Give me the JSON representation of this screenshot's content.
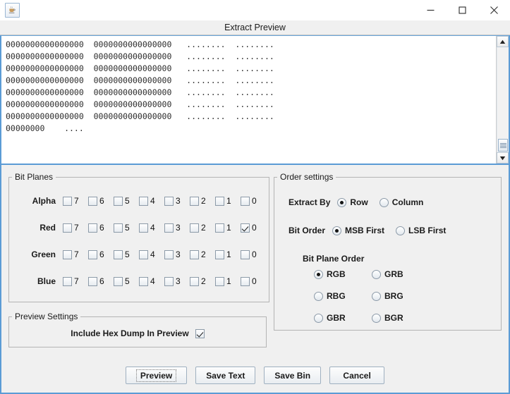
{
  "window": {
    "app_icon": "java-coffee-cup-icon",
    "minimize_label": "–",
    "maximize_label": "□",
    "close_label": "×"
  },
  "header": {
    "title": "Extract Preview"
  },
  "preview": {
    "lines": [
      "0000000000000000  0000000000000000   ........  ........",
      "0000000000000000  0000000000000000   ........  ........",
      "0000000000000000  0000000000000000   ........  ........",
      "0000000000000000  0000000000000000   ........  ........",
      "0000000000000000  0000000000000000   ........  ........",
      "0000000000000000  0000000000000000   ........  ........",
      "0000000000000000  0000000000000000   ........  ........",
      "00000000    ...."
    ],
    "scrollbar": {
      "up_arrow": "scroll-up-icon",
      "down_arrow": "scroll-down-icon"
    }
  },
  "bit_planes": {
    "legend": "Bit Planes",
    "bits": [
      "7",
      "6",
      "5",
      "4",
      "3",
      "2",
      "1",
      "0"
    ],
    "rows": [
      {
        "label": "Alpha",
        "checked": [
          false,
          false,
          false,
          false,
          false,
          false,
          false,
          false
        ]
      },
      {
        "label": "Red",
        "checked": [
          false,
          false,
          false,
          false,
          false,
          false,
          false,
          true
        ]
      },
      {
        "label": "Green",
        "checked": [
          false,
          false,
          false,
          false,
          false,
          false,
          false,
          false
        ]
      },
      {
        "label": "Blue",
        "checked": [
          false,
          false,
          false,
          false,
          false,
          false,
          false,
          false
        ]
      }
    ]
  },
  "preview_settings": {
    "legend": "Preview Settings",
    "include_hex_dump_label": "Include Hex Dump In Preview",
    "include_hex_dump_checked": true
  },
  "order_settings": {
    "legend": "Order settings",
    "extract_by_label": "Extract By",
    "extract_by_options": [
      {
        "label": "Row",
        "selected": true
      },
      {
        "label": "Column",
        "selected": false
      }
    ],
    "bit_order_label": "Bit Order",
    "bit_order_options": [
      {
        "label": "MSB First",
        "selected": true
      },
      {
        "label": "LSB First",
        "selected": false
      }
    ],
    "bit_plane_order_label": "Bit Plane Order",
    "bit_plane_order_options": [
      {
        "label": "RGB",
        "selected": true
      },
      {
        "label": "GRB",
        "selected": false
      },
      {
        "label": "RBG",
        "selected": false
      },
      {
        "label": "BRG",
        "selected": false
      },
      {
        "label": "GBR",
        "selected": false
      },
      {
        "label": "BGR",
        "selected": false
      }
    ]
  },
  "buttons": [
    {
      "label": "Preview",
      "focused": true
    },
    {
      "label": "Save Text",
      "focused": false
    },
    {
      "label": "Save Bin",
      "focused": false
    },
    {
      "label": "Cancel",
      "focused": false
    }
  ],
  "colors": {
    "accent_border": "#5b9bd5",
    "panel_bg": "#f0f0f0",
    "text": "#1a1a1a"
  }
}
